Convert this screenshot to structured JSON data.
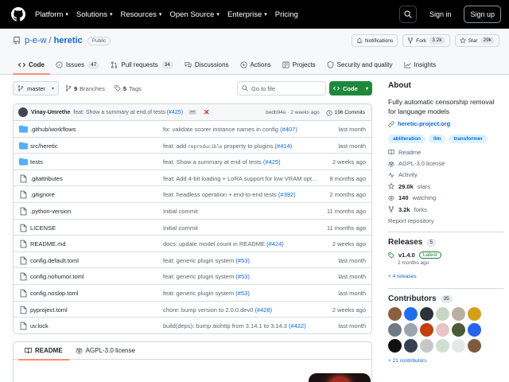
{
  "nav": {
    "links": [
      {
        "label": "Platform",
        "chevron": true
      },
      {
        "label": "Solutions",
        "chevron": true
      },
      {
        "label": "Resources",
        "chevron": true
      },
      {
        "label": "Open Source",
        "chevron": true
      },
      {
        "label": "Enterprise",
        "chevron": true
      },
      {
        "label": "Pricing",
        "chevron": false
      }
    ],
    "signin": "Sign in",
    "signup": "Sign up"
  },
  "repo": {
    "owner": "p-e-w",
    "name": "heretic",
    "visibility": "Public",
    "notifications_label": "Notifications",
    "fork_label": "Fork",
    "fork_count": "3.2k",
    "star_label": "Star",
    "star_count": "29k"
  },
  "tabs": [
    {
      "label": "Code",
      "count": "",
      "icon": "code-icon"
    },
    {
      "label": "Issues",
      "count": "47",
      "icon": "issue-icon"
    },
    {
      "label": "Pull requests",
      "count": "34",
      "icon": "pull-request-icon"
    },
    {
      "label": "Discussions",
      "count": "",
      "icon": "discussion-icon"
    },
    {
      "label": "Actions",
      "count": "",
      "icon": "actions-icon"
    },
    {
      "label": "Projects",
      "count": "",
      "icon": "projects-icon"
    },
    {
      "label": "Security and quality",
      "count": "",
      "icon": "shield-icon"
    },
    {
      "label": "Insights",
      "count": "",
      "icon": "graph-icon"
    }
  ],
  "branchbar": {
    "branch": "master",
    "branches_count": "9",
    "branches_label": "Branches",
    "tags_count": "5",
    "tags_label": "Tags",
    "goto_placeholder": "Go to file",
    "code_label": "Code"
  },
  "latest_commit": {
    "author": "Vinay-Umrethe",
    "message": "feat: Show a summary at end of tests",
    "pr": "(#425)",
    "hash": "bedb94e",
    "time": "2 weeks ago",
    "commits_label": "196 Commits"
  },
  "files": [
    {
      "type": "dir",
      "name": ".github/workflows",
      "msg": "fix: validate scorer instance names in config",
      "code": "",
      "tail": "",
      "pr": "(#407)",
      "date": "last month"
    },
    {
      "type": "dir",
      "name": "src/heretic",
      "msg": "feat: add",
      "code": "reproducible",
      "tail": "property to plugins",
      "pr": "(#414)",
      "date": "last month"
    },
    {
      "type": "dir",
      "name": "tests",
      "msg": "feat: Show a summary at end of tests",
      "code": "",
      "tail": "",
      "pr": "(#425)",
      "date": "2 weeks ago"
    },
    {
      "type": "file",
      "name": ".gitattributes",
      "msg": "feat: Add 4-bit loading + LoRA support for low VRAM optimiz...",
      "code": "",
      "tail": "",
      "pr": "",
      "date": "8 months ago"
    },
    {
      "type": "file",
      "name": ".gitignore",
      "msg": "feat: headless operation + end-to-end tests",
      "code": "",
      "tail": "",
      "pr": "(#392)",
      "date": "2 months ago"
    },
    {
      "type": "file",
      "name": ".python-version",
      "msg": "Initial commit",
      "code": "",
      "tail": "",
      "pr": "",
      "date": "11 months ago"
    },
    {
      "type": "file",
      "name": "LICENSE",
      "msg": "Initial commit",
      "code": "",
      "tail": "",
      "pr": "",
      "date": "11 months ago"
    },
    {
      "type": "file",
      "name": "README.md",
      "msg": "docs: update model count in README",
      "code": "",
      "tail": "",
      "pr": "(#424)",
      "date": "2 weeks ago"
    },
    {
      "type": "file",
      "name": "config.default.toml",
      "msg": "feat: generic plugin system",
      "code": "",
      "tail": "",
      "pr": "(#53)",
      "date": "last month"
    },
    {
      "type": "file",
      "name": "config.nohumor.toml",
      "msg": "feat: generic plugin system",
      "code": "",
      "tail": "",
      "pr": "(#53)",
      "date": "last month"
    },
    {
      "type": "file",
      "name": "config.noslop.toml",
      "msg": "feat: generic plugin system",
      "code": "",
      "tail": "",
      "pr": "(#53)",
      "date": "last month"
    },
    {
      "type": "file",
      "name": "pyproject.toml",
      "msg": "chore: bump version to 2.0.0.dev0",
      "code": "",
      "tail": "",
      "pr": "(#428)",
      "date": "2 weeks ago"
    },
    {
      "type": "file",
      "name": "uv.lock",
      "msg": "build(deps): bump aiohttp from 3.14.1 to 3.14.3",
      "code": "",
      "tail": "",
      "pr": "(#422)",
      "date": "last month"
    }
  ],
  "readme_tabs": [
    {
      "label": "README",
      "icon": "book-icon"
    },
    {
      "label": "AGPL-3.0 license",
      "icon": "law-icon"
    }
  ],
  "about": {
    "title": "About",
    "description": "Fully automatic censorship removal for language models",
    "homepage": "heretic-project.org",
    "topics": [
      "abliteration",
      "llm",
      "transformer"
    ],
    "readme": "Readme",
    "license": "AGPL-3.0 license",
    "activity": "Activity",
    "stars_count": "29.0k",
    "stars_label": "stars",
    "watching_count": "140",
    "watching_label": "watching",
    "forks_count": "3.2k",
    "forks_label": "forks",
    "report": "Report repository"
  },
  "releases": {
    "title": "Releases",
    "count": "5",
    "version": "v1.4.0",
    "latest_label": "Latest",
    "date": "2 months ago",
    "more": "+ 4 releases"
  },
  "contributors": {
    "title": "Contributors",
    "count": "35",
    "more": "+ 21 contributors",
    "avatar_colors": [
      "#8b5e3c",
      "#1f6feb",
      "#2d333b",
      "#c9d6c2",
      "#b8b0a0",
      "#d4a017",
      "#6f7a85",
      "#9aa5b1",
      "#c2410c",
      "#e8c4c4",
      "#4a5a3a",
      "#2563eb",
      "#111111",
      "#374151",
      "#c7c7c7",
      "#d0e0d0",
      "#e5e7eb",
      "#7c5c3c"
    ]
  }
}
